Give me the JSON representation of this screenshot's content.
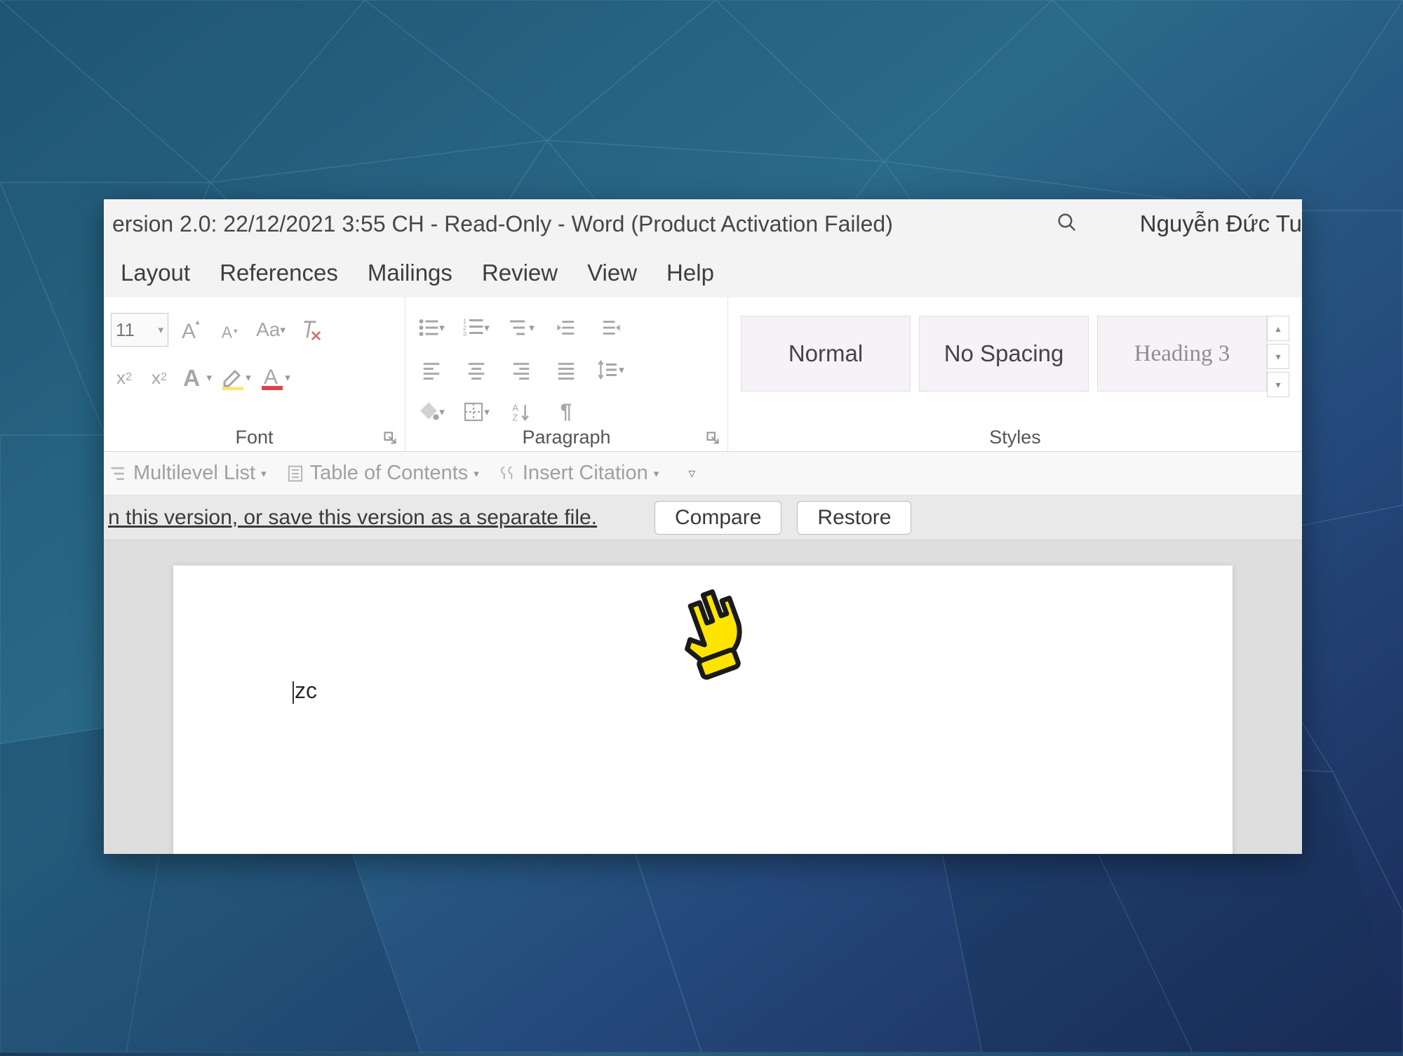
{
  "titlebar": {
    "title": "ersion 2.0: 22/12/2021 3:55 CH  -  Read-Only  -  Word (Product Activation Failed)",
    "user": "Nguyễn Đức Tu"
  },
  "tabs": {
    "items": [
      "Layout",
      "References",
      "Mailings",
      "Review",
      "View",
      "Help"
    ]
  },
  "ribbon": {
    "font": {
      "label": "Font",
      "size": "11"
    },
    "paragraph": {
      "label": "Paragraph"
    },
    "styles": {
      "label": "Styles",
      "items": [
        "Normal",
        "No Spacing",
        "Heading 3"
      ]
    }
  },
  "toolbar2": {
    "multilevel": "Multilevel List",
    "toc": "Table of Contents",
    "citation": "Insert Citation"
  },
  "versionbar": {
    "message": "n this version, or save this version as a separate file.",
    "compare": "Compare",
    "restore": "Restore"
  },
  "document": {
    "text": "zc"
  }
}
